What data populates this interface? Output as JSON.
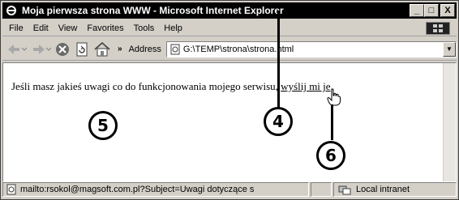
{
  "window": {
    "title": "Moja pierwsza strona WWW - Microsoft Internet Explorer",
    "controls": {
      "minimize": "_",
      "maximize": "□",
      "close": "X"
    }
  },
  "menu": {
    "items": [
      {
        "label": "File"
      },
      {
        "label": "Edit"
      },
      {
        "label": "View"
      },
      {
        "label": "Favorites"
      },
      {
        "label": "Tools"
      },
      {
        "label": "Help"
      }
    ]
  },
  "toolbar": {
    "icons": [
      "back-icon",
      "forward-icon",
      "stop-icon",
      "refresh-icon",
      "home-icon"
    ],
    "overflow": "»",
    "address_label": "Address",
    "address_value": "G:\\TEMP\\strona\\strona.html"
  },
  "page": {
    "text_before": "Jeśli masz jakieś uwagi co do funkcjonowania mojego serwisu, ",
    "link_text": "wyślij mi je",
    "text_after": "."
  },
  "callouts": [
    {
      "label": "5"
    },
    {
      "label": "4"
    },
    {
      "label": "6"
    }
  ],
  "status": {
    "text": "mailto:rsokol@magsoft.com.pl?Subject=Uwagi dotyczące s",
    "zone": "Local intranet"
  },
  "colors": {
    "titlebar": "#000000",
    "chrome": "#d4d0c8"
  }
}
